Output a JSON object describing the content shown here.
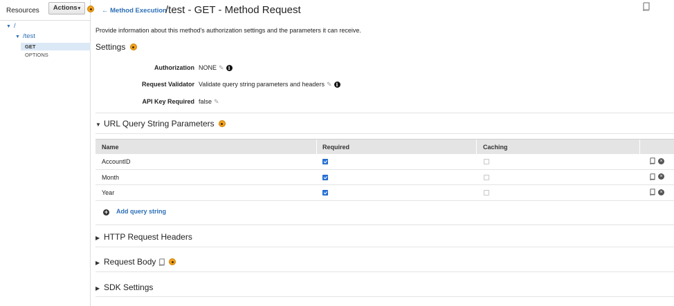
{
  "sidebar": {
    "header_label": "Resources",
    "actions_label": "Actions",
    "tree": {
      "root": "/",
      "child": "/test",
      "methods": [
        "GET",
        "OPTIONS"
      ]
    }
  },
  "header": {
    "back_link": "Method Execution",
    "title": "/test - GET - Method Request"
  },
  "description": "Provide information about this method's authorization settings and the parameters it can receive.",
  "settings": {
    "title": "Settings",
    "authorization": {
      "label": "Authorization",
      "value": "NONE"
    },
    "request_validator": {
      "label": "Request Validator",
      "value": "Validate query string parameters and headers"
    },
    "api_key_required": {
      "label": "API Key Required",
      "value": "false"
    }
  },
  "query_params": {
    "title": "URL Query String Parameters",
    "columns": [
      "Name",
      "Required",
      "Caching"
    ],
    "rows": [
      {
        "name": "AccountID",
        "required": true,
        "caching": false
      },
      {
        "name": "Month",
        "required": true,
        "caching": false
      },
      {
        "name": "Year",
        "required": true,
        "caching": false
      }
    ],
    "add_label": "Add query string"
  },
  "sections": {
    "http_headers": "HTTP Request Headers",
    "request_body": "Request Body",
    "sdk_settings": "SDK Settings"
  },
  "colors": {
    "link": "#2c6fb6",
    "info_badge": "#f4a21a",
    "selected_row": "#dbe8f6",
    "checkbox_on": "#2c7be5"
  },
  "icons": {
    "edit": "pencil-icon",
    "info": "info-icon",
    "docs": "book-icon",
    "remove": "close-circle-icon",
    "add": "plus-circle-icon"
  }
}
